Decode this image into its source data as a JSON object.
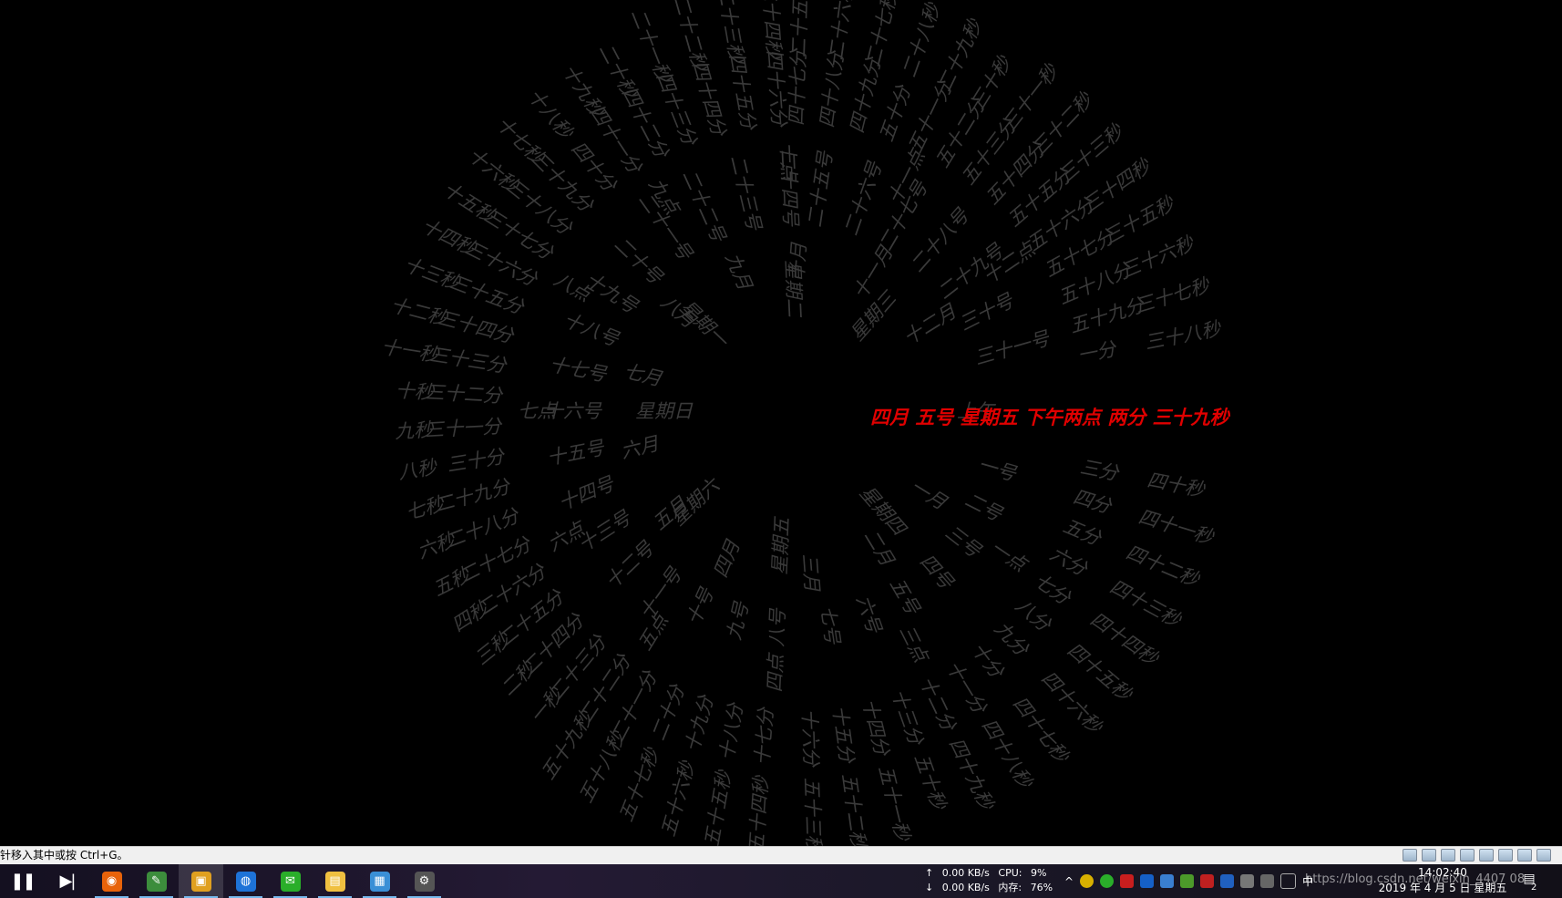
{
  "colors": {
    "background": "#000000",
    "ring_text": "#3a3a3a",
    "current_text": "#e00000",
    "taskbar": "#1b1828",
    "vm_bar": "#f0f0f0"
  },
  "clock": {
    "current_time_line": "四月 五号 星期五 下午两点 两分 三十九秒",
    "rings": {
      "ampm": [
        "上午"
      ],
      "weekdays": [
        "星期四",
        "星期五",
        "星期六",
        "星期日",
        "星期一",
        "星期二",
        "星期三"
      ],
      "months": [
        "一月",
        "二月",
        "三月",
        "四月",
        "五月",
        "六月",
        "七月",
        "八月",
        "九月",
        "十月",
        "十一月",
        "十二月"
      ],
      "days": [
        "一号",
        "二号",
        "三号",
        "四号",
        "五号",
        "六号",
        "七号",
        "八号",
        "九号",
        "十号",
        "十一号",
        "十二号",
        "十三号",
        "十四号",
        "十五号",
        "十六号",
        "十七号",
        "十八号",
        "十九号",
        "二十号",
        "二十一号",
        "二十二号",
        "二十三号",
        "二十四号",
        "二十五号",
        "二十六号",
        "二十七号",
        "二十八号",
        "二十九号",
        "三十号",
        "三十一号"
      ],
      "hours": [
        "一点",
        "三点",
        "四点",
        "五点",
        "六点",
        "七点",
        "八点",
        "九点",
        "十点",
        "十一点",
        "十二点"
      ],
      "minutes": [
        "三分",
        "四分",
        "五分",
        "六分",
        "七分",
        "八分",
        "九分",
        "十分",
        "十一分",
        "十二分",
        "十三分",
        "十四分",
        "十五分",
        "十六分",
        "十七分",
        "十八分",
        "十九分",
        "二十分",
        "二十一分",
        "二十二分",
        "二十三分",
        "二十四分",
        "二十五分",
        "二十六分",
        "二十七分",
        "二十八分",
        "二十九分",
        "三十分",
        "三十一分",
        "三十二分",
        "三十三分",
        "三十四分",
        "三十五分",
        "三十六分",
        "三十七分",
        "三十八分",
        "三十九分",
        "四十分",
        "四十一分",
        "四十二分",
        "四十三分",
        "四十四分",
        "四十五分",
        "四十六分",
        "四十七分",
        "四十八分",
        "四十九分",
        "五十分",
        "五十一分",
        "五十二分",
        "五十三分",
        "五十四分",
        "五十五分",
        "五十六分",
        "五十七分",
        "五十八分",
        "五十九分",
        "一分"
      ],
      "seconds": [
        "四十秒",
        "四十一秒",
        "四十二秒",
        "四十三秒",
        "四十四秒",
        "四十五秒",
        "四十六秒",
        "四十七秒",
        "四十八秒",
        "四十九秒",
        "五十秒",
        "五十一秒",
        "五十二秒",
        "五十三秒",
        "五十四秒",
        "五十五秒",
        "五十六秒",
        "五十七秒",
        "五十八秒",
        "五十九秒",
        "一秒",
        "二秒",
        "三秒",
        "四秒",
        "五秒",
        "六秒",
        "七秒",
        "八秒",
        "九秒",
        "十秒",
        "十一秒",
        "十二秒",
        "十三秒",
        "十四秒",
        "十五秒",
        "十六秒",
        "十七秒",
        "十八秒",
        "十九秒",
        "二十秒",
        "二十一秒",
        "二十二秒",
        "二十三秒",
        "二十四秒",
        "二十五秒",
        "二十六秒",
        "二十七秒",
        "二十八秒",
        "二十九秒",
        "三十秒",
        "三十一秒",
        "三十二秒",
        "三十三秒",
        "三十四秒",
        "三十五秒",
        "三十六秒",
        "三十七秒",
        "三十八秒"
      ]
    }
  },
  "vm_bar": {
    "hint": "针移入其中或按 Ctrl+G。"
  },
  "taskbar": {
    "controls": {
      "pause_icon": "pause-icon",
      "next_icon": "skip-next-icon"
    },
    "apps": [
      {
        "name": "firefox-icon",
        "color": "#e8630a",
        "running": true
      },
      {
        "name": "notepad-icon",
        "color": "#3c8d3c",
        "running": true
      },
      {
        "name": "vmware-icon",
        "color": "#e0a020",
        "running": true,
        "active": true
      },
      {
        "name": "browser-icon",
        "color": "#1e73d8",
        "running": true
      },
      {
        "name": "wechat-icon",
        "color": "#2aae2a",
        "running": true
      },
      {
        "name": "file-explorer-icon",
        "color": "#f0c040",
        "running": true
      },
      {
        "name": "remote-desktop-icon",
        "color": "#3a8fd6",
        "running": true
      },
      {
        "name": "settings-icon",
        "color": "#555555",
        "running": true
      }
    ],
    "net": {
      "up_arrow": "↑",
      "down_arrow": "↓",
      "up_speed": "0.00 KB/s",
      "down_speed": "0.00 KB/s",
      "cpu_label": "CPU:",
      "cpu_value": "9%",
      "mem_label": "内存:",
      "mem_value": "76%"
    },
    "tray": {
      "chevron": "^",
      "ime_mode": "中",
      "url_watermark": "https://blog.csdn.net/weixin_4407 08",
      "time": "14:02:40",
      "date": "2019 年 4 月 5 日 星期五",
      "notification_count": "2"
    }
  }
}
